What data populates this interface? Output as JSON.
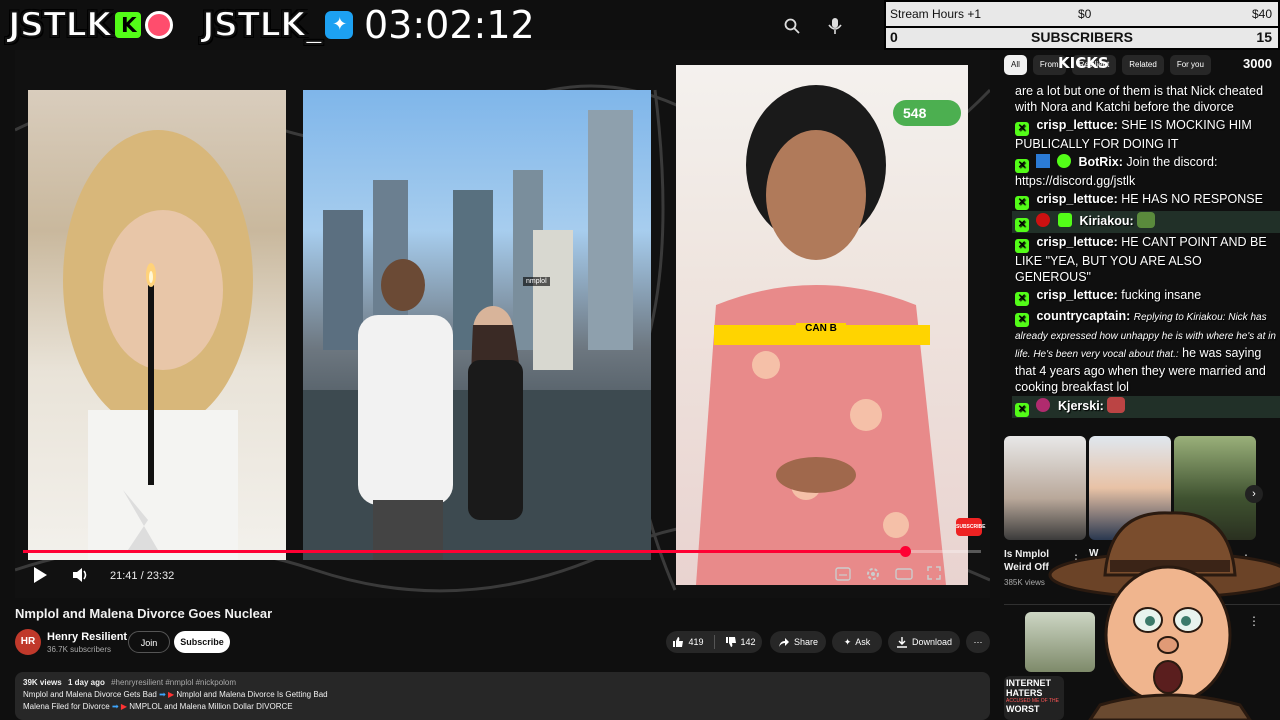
{
  "overlay": {
    "logo1": "JSTLK",
    "logo1_badge": "K",
    "logo2": "JSTLK_",
    "timer": "03:02:12"
  },
  "stream_hours": {
    "label": "Stream Hours +1",
    "left_amount": "$0",
    "right_amount": "$40",
    "sub_left": "0",
    "sub_label": "SUBSCRIBERS",
    "sub_right": "15"
  },
  "video": {
    "pane2_label": "nmplol",
    "caption": "CAN B",
    "progress": 0.921,
    "timecode": "21:41 / 23:32",
    "like_counter": "548",
    "subscribe_tag": "SUBSCRIBE"
  },
  "title": "Nmplol and Malena Divorce Goes Nuclear",
  "channel": {
    "avatar_text": "HR",
    "name": "Henry Resilient",
    "subscribers": "36.7K subscribers",
    "join": "Join",
    "subscribe": "Subscribe"
  },
  "actions": {
    "likes": "419",
    "dislikes": "142",
    "share": "Share",
    "ask": "Ask",
    "download": "Download"
  },
  "description": {
    "views": "39K views",
    "age": "1 day ago",
    "tags": "#henryresilient #nmplol #nickpolom",
    "line1_a": "Nmplol and Malena Divorce Gets Bad",
    "line1_b": "Nmplol and Malena Divorce Is Getting Bad",
    "line2_a": "Malena Filed for Divorce",
    "line2_b": "NMPLOL and Malena Million Dollar DIVORCE"
  },
  "sidebar": {
    "chips": [
      "All",
      "From",
      "Resilient",
      "Related",
      "For you"
    ],
    "kicks_label": "KICKS",
    "kicks_count": "3000",
    "related_title": "Is Nmplol Weird Off",
    "related_views": "385K views",
    "related_title2": "W",
    "thumb_text": "INTERNET HATERS",
    "thumb_sub": "ACCUSED ME OF THE",
    "thumb_worst": "WORST"
  },
  "chat": [
    {
      "user": "",
      "text": "are a lot but one of them is that Nick cheated with Nora and Katchi before the divorce"
    },
    {
      "user": "crisp_lettuce:",
      "text": "SHE IS MOCKING HIM PUBLICALLY FOR DOING IT"
    },
    {
      "user": "BotRix:",
      "text": "Join the discord: https://discord.gg/jstlk"
    },
    {
      "user": "crisp_lettuce:",
      "text": "HE HAS NO RESPONSE"
    },
    {
      "user": "Kiriakou:",
      "text": ""
    },
    {
      "user": "crisp_lettuce:",
      "text": "HE CANT POINT AND BE LIKE \"YEA, BUT YOU ARE ALSO GENEROUS\""
    },
    {
      "user": "crisp_lettuce:",
      "text": "fucking insane"
    },
    {
      "user": "countrycaptain:",
      "reply": "Replying to Kiriakou: Nick has already expressed how unhappy he is with where he's at in life. He's been very vocal about that.:",
      "text": "he was saying that 4 years ago when they were married and cooking breakfast lol"
    },
    {
      "user": "Kjerski:",
      "text": ""
    }
  ],
  "colors": {
    "kick_green": "#53fc18",
    "progress_red": "#ff0033",
    "caption_yellow": "#ffd400"
  }
}
